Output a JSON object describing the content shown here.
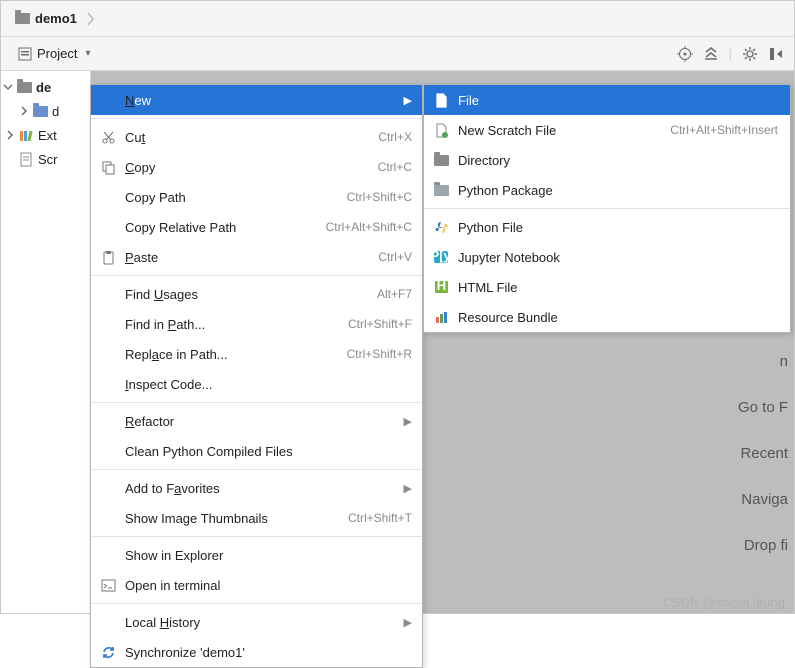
{
  "breadcrumb": {
    "project_name": "demo1"
  },
  "toolbar": {
    "project_label": "Project"
  },
  "tree": {
    "root": "de",
    "child1": "d",
    "ext": "Ext",
    "scr": "Scr"
  },
  "context_menu": {
    "new": "New",
    "cut": {
      "label": "Cut",
      "shortcut": "Ctrl+X"
    },
    "copy": {
      "label": "Copy",
      "shortcut": "Ctrl+C"
    },
    "copy_path": {
      "label": "Copy Path",
      "shortcut": "Ctrl+Shift+C"
    },
    "copy_rel_path": {
      "label": "Copy Relative Path",
      "shortcut": "Ctrl+Alt+Shift+C"
    },
    "paste": {
      "label": "Paste",
      "shortcut": "Ctrl+V"
    },
    "find_usages": {
      "label": "Find Usages",
      "shortcut": "Alt+F7"
    },
    "find_in_path": {
      "label": "Find in Path...",
      "shortcut": "Ctrl+Shift+F"
    },
    "replace_in_path": {
      "label": "Replace in Path...",
      "shortcut": "Ctrl+Shift+R"
    },
    "inspect_code": {
      "label": "Inspect Code..."
    },
    "refactor": {
      "label": "Refactor"
    },
    "clean_pyc": {
      "label": "Clean Python Compiled Files"
    },
    "add_fav": {
      "label": "Add to Favorites"
    },
    "show_thumbs": {
      "label": "Show Image Thumbnails",
      "shortcut": "Ctrl+Shift+T"
    },
    "show_explorer": {
      "label": "Show in Explorer"
    },
    "open_terminal": {
      "label": "Open in terminal"
    },
    "local_history": {
      "label": "Local History"
    },
    "synchronize": {
      "label": "Synchronize 'demo1'"
    }
  },
  "submenu": {
    "file": "File",
    "scratch": {
      "label": "New Scratch File",
      "shortcut": "Ctrl+Alt+Shift+Insert"
    },
    "directory": "Directory",
    "py_package": "Python Package",
    "py_file": "Python File",
    "jupyter": "Jupyter Notebook",
    "html_file": "HTML File",
    "resource_bundle": "Resource Bundle"
  },
  "hints": {
    "h0": "n",
    "h1": "Go to F",
    "h2": "Recent",
    "h3": "Naviga",
    "h4": "Drop fi"
  },
  "watermark": "CSDN @swain.leung"
}
